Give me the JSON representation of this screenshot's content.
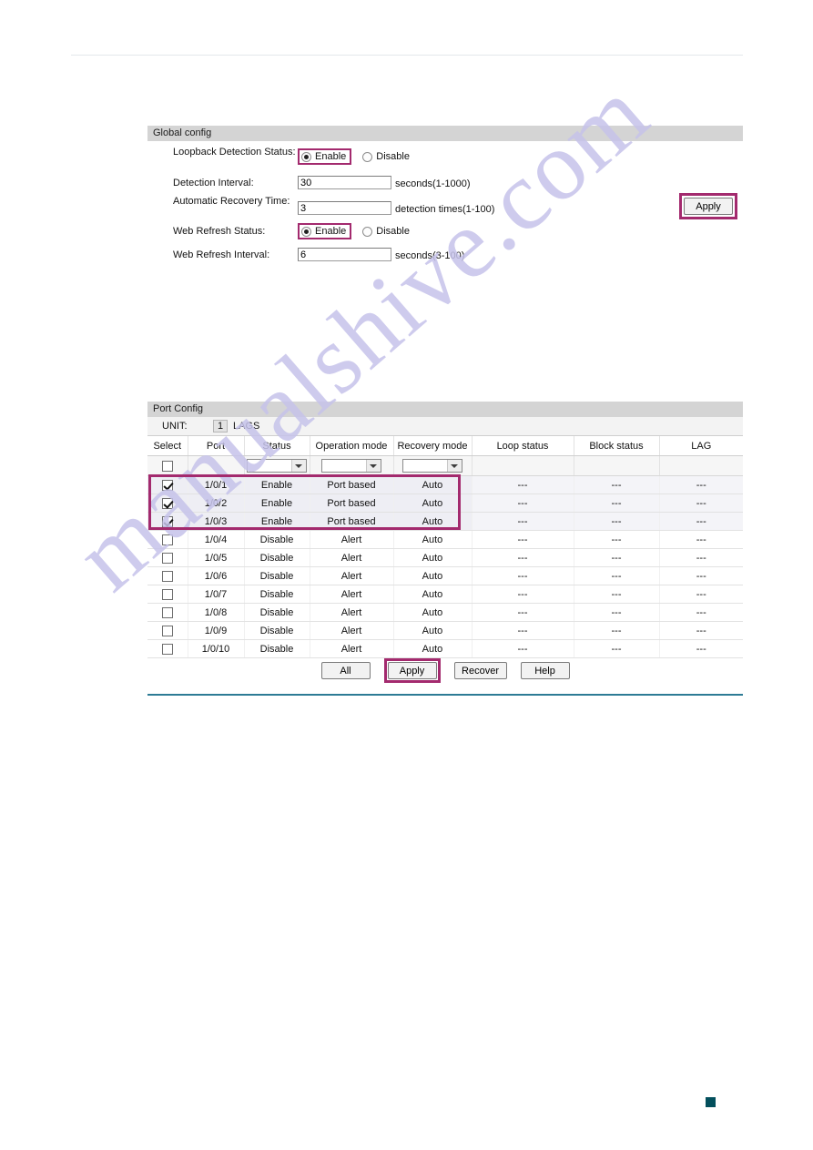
{
  "watermark": {
    "text": "manualshive.com",
    "color": "#c6c3ea"
  },
  "accent": {
    "highlight": "#a32a6e",
    "rule": "#2d7b95",
    "panel_header_bg": "#d4d4d4"
  },
  "global_config": {
    "title": "Global config",
    "rows": [
      {
        "label": "Loopback Detection Status:",
        "type": "radio",
        "options": [
          "Enable",
          "Disable"
        ],
        "selected": "Enable",
        "highlighted": true
      },
      {
        "label": "Detection Interval:",
        "type": "text",
        "value": "30",
        "suffix": "seconds(1-1000)"
      },
      {
        "label": "Automatic Recovery Time:",
        "type": "text",
        "value": "3",
        "suffix": "detection times(1-100)"
      },
      {
        "label": "Web Refresh Status:",
        "type": "radio",
        "options": [
          "Enable",
          "Disable"
        ],
        "selected": "Enable",
        "highlighted": true
      },
      {
        "label": "Web Refresh Interval:",
        "type": "text",
        "value": "6",
        "suffix": "seconds(3-100)"
      }
    ],
    "labels": {
      "loopback_status": "Loopback Detection Status:",
      "detection_interval": "Detection Interval:",
      "auto_recovery": "Automatic Recovery Time:",
      "web_refresh_status": "Web Refresh Status:",
      "web_refresh_interval": "Web Refresh Interval:"
    },
    "values": {
      "detection_interval": "30",
      "auto_recovery": "3",
      "web_refresh_interval": "6"
    },
    "suffixes": {
      "detection_interval": "seconds(1-1000)",
      "auto_recovery": "detection times(1-100)",
      "web_refresh_interval": "seconds(3-100)"
    },
    "radio": {
      "enable": "Enable",
      "disable": "Disable"
    },
    "apply_label": "Apply"
  },
  "port_config": {
    "title": "Port Config",
    "unit_label": "UNIT:",
    "unit_value": "1",
    "lags_label": "LAGS",
    "columns": [
      "Select",
      "Port",
      "Status",
      "Operation mode",
      "Recovery mode",
      "Loop status",
      "Block status",
      "LAG"
    ],
    "filter_row": {
      "select_checked": false,
      "status": "",
      "operation_mode": "",
      "recovery_mode": ""
    },
    "rows": [
      {
        "select": true,
        "port": "1/0/1",
        "status": "Enable",
        "operation_mode": "Port based",
        "recovery_mode": "Auto",
        "loop_status": "---",
        "block_status": "---",
        "lag": "---",
        "shaded": true
      },
      {
        "select": true,
        "port": "1/0/2",
        "status": "Enable",
        "operation_mode": "Port based",
        "recovery_mode": "Auto",
        "loop_status": "---",
        "block_status": "---",
        "lag": "---",
        "shaded": true
      },
      {
        "select": true,
        "port": "1/0/3",
        "status": "Enable",
        "operation_mode": "Port based",
        "recovery_mode": "Auto",
        "loop_status": "---",
        "block_status": "---",
        "lag": "---",
        "shaded": true
      },
      {
        "select": false,
        "port": "1/0/4",
        "status": "Disable",
        "operation_mode": "Alert",
        "recovery_mode": "Auto",
        "loop_status": "---",
        "block_status": "---",
        "lag": "---",
        "shaded": false
      },
      {
        "select": false,
        "port": "1/0/5",
        "status": "Disable",
        "operation_mode": "Alert",
        "recovery_mode": "Auto",
        "loop_status": "---",
        "block_status": "---",
        "lag": "---",
        "shaded": false
      },
      {
        "select": false,
        "port": "1/0/6",
        "status": "Disable",
        "operation_mode": "Alert",
        "recovery_mode": "Auto",
        "loop_status": "---",
        "block_status": "---",
        "lag": "---",
        "shaded": false
      },
      {
        "select": false,
        "port": "1/0/7",
        "status": "Disable",
        "operation_mode": "Alert",
        "recovery_mode": "Auto",
        "loop_status": "---",
        "block_status": "---",
        "lag": "---",
        "shaded": false
      },
      {
        "select": false,
        "port": "1/0/8",
        "status": "Disable",
        "operation_mode": "Alert",
        "recovery_mode": "Auto",
        "loop_status": "---",
        "block_status": "---",
        "lag": "---",
        "shaded": false
      },
      {
        "select": false,
        "port": "1/0/9",
        "status": "Disable",
        "operation_mode": "Alert",
        "recovery_mode": "Auto",
        "loop_status": "---",
        "block_status": "---",
        "lag": "---",
        "shaded": false
      },
      {
        "select": false,
        "port": "1/0/10",
        "status": "Disable",
        "operation_mode": "Alert",
        "recovery_mode": "Auto",
        "loop_status": "---",
        "block_status": "---",
        "lag": "---",
        "shaded": false
      }
    ],
    "buttons": [
      {
        "label": "All",
        "highlighted": false
      },
      {
        "label": "Apply",
        "highlighted": true
      },
      {
        "label": "Recover",
        "highlighted": false
      },
      {
        "label": "Help",
        "highlighted": false
      }
    ]
  }
}
